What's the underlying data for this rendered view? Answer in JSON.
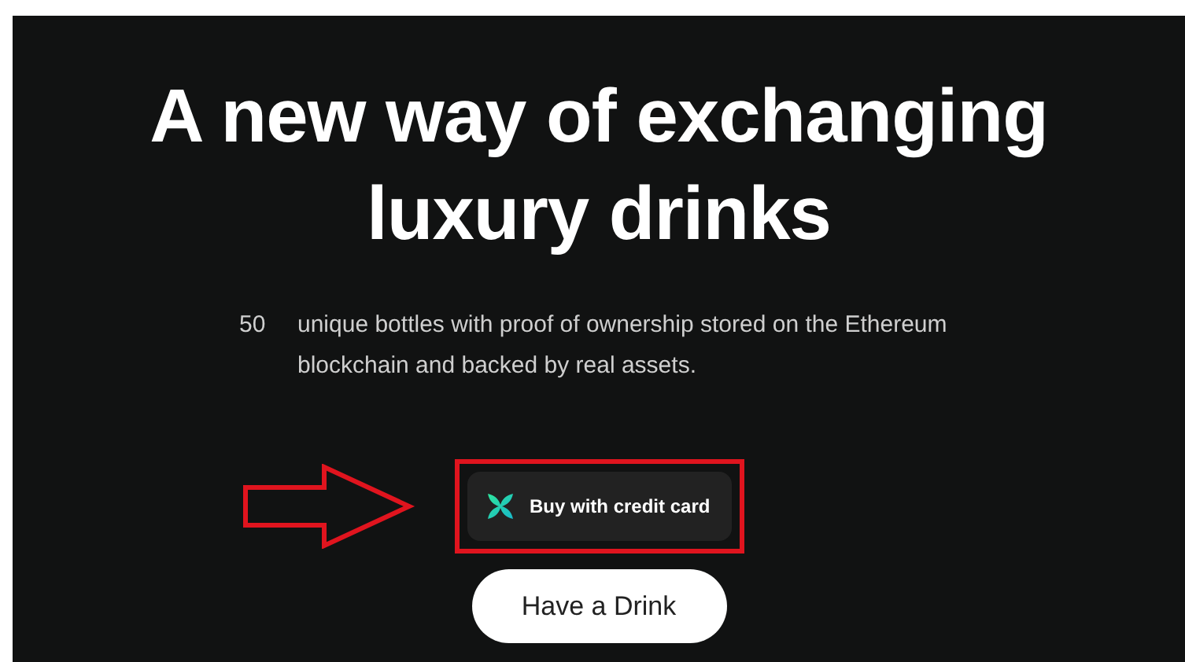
{
  "hero": {
    "title": "A new way of exchanging luxury drinks",
    "count": "50",
    "description": "unique bottles with proof of ownership stored on the Ethereum blockchain and backed by real assets."
  },
  "buttons": [
    {
      "kind": "crypto",
      "label": "Buy with credit card",
      "highlighted": true
    },
    {
      "kind": "pill",
      "label": "Have a Drink"
    }
  ]
}
